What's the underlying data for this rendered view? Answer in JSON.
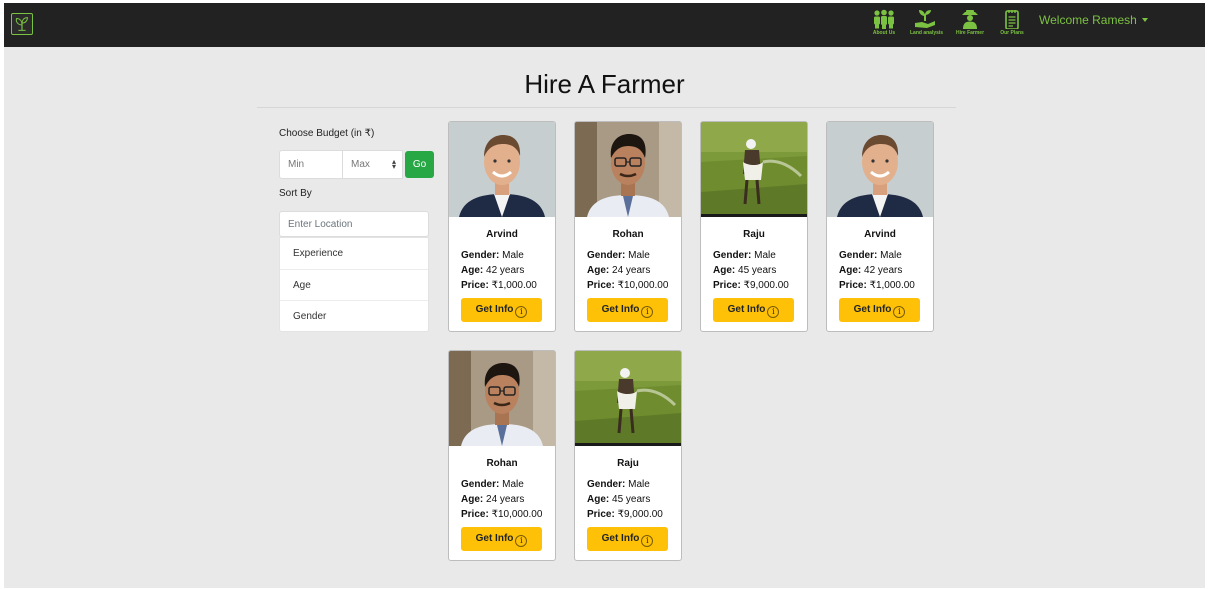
{
  "navbar": {
    "logo_icon": "leaf-logo-icon",
    "items": [
      {
        "label": "About Us",
        "icon": "people-icon"
      },
      {
        "label": "Land analysis",
        "icon": "plant-hand-icon"
      },
      {
        "label": "Hire Farmer",
        "icon": "farmer-icon"
      },
      {
        "label": "Our Plans",
        "icon": "notepad-icon"
      }
    ],
    "welcome": "Welcome Ramesh",
    "accent": "#7cc242"
  },
  "page": {
    "title": "Hire A Farmer"
  },
  "filters": {
    "budget_label": "Choose Budget (in ₹)",
    "min_placeholder": "Min",
    "max_placeholder": "Max",
    "go_label": "Go",
    "sort_label": "Sort By",
    "location_placeholder": "Enter Location",
    "sort_options": [
      "Experience",
      "Age",
      "Gender"
    ]
  },
  "labels": {
    "gender": "Gender:",
    "age": "Age:",
    "price": "Price:",
    "get_info": "Get Info",
    "info_glyph": "i"
  },
  "farmers": [
    {
      "name": "Arvind",
      "gender": "Male",
      "age": "42 years",
      "price": "₹1,000.00",
      "photo": "man-suit-photo"
    },
    {
      "name": "Rohan",
      "gender": "Male",
      "age": "24 years",
      "price": "₹10,000.00",
      "photo": "man-glasses-photo"
    },
    {
      "name": "Raju",
      "gender": "Male",
      "age": "45 years",
      "price": "₹9,000.00",
      "photo": "farmer-field-photo"
    },
    {
      "name": "Arvind",
      "gender": "Male",
      "age": "42 years",
      "price": "₹1,000.00",
      "photo": "man-suit-photo"
    },
    {
      "name": "Rohan",
      "gender": "Male",
      "age": "24 years",
      "price": "₹10,000.00",
      "photo": "man-glasses-photo"
    },
    {
      "name": "Raju",
      "gender": "Male",
      "age": "45 years",
      "price": "₹9,000.00",
      "photo": "farmer-field-photo"
    }
  ],
  "colors": {
    "navbar": "#222222",
    "go": "#28a745",
    "get_info": "#ffc107",
    "background": "#e9e9e9"
  }
}
